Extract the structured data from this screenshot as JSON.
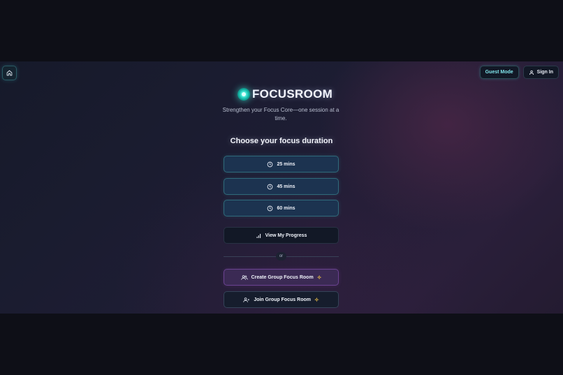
{
  "header": {
    "guest_label": "Guest Mode",
    "signin_label": "Sign In"
  },
  "brand": {
    "name": "FOCUSROOM",
    "tagline": "Strengthen your Focus Core—one session at a time."
  },
  "duration": {
    "heading": "Choose your focus duration",
    "options": [
      "25 mins",
      "45 mins",
      "60 mins"
    ]
  },
  "actions": {
    "progress_label": "View My Progress",
    "divider_text": "or",
    "create_group_label": "Create Group Focus Room",
    "join_group_label": "Join Group Focus Room"
  },
  "colors": {
    "accent": "#4ff0de",
    "duration_button": "#1c3350",
    "create_button": "#3b2a54"
  }
}
